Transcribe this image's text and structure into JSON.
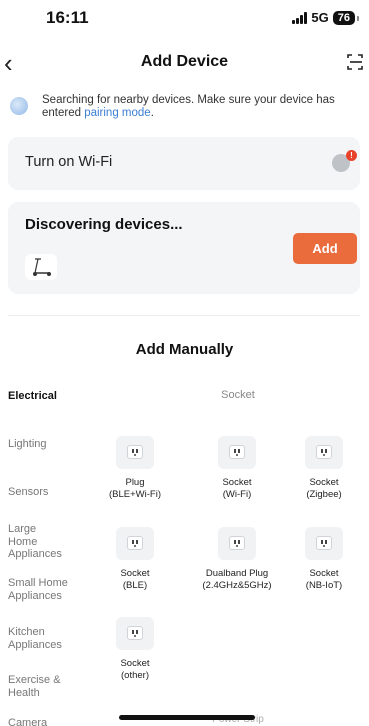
{
  "status_bar": {
    "time": "16:11",
    "network": "5G",
    "battery": "76"
  },
  "nav": {
    "title": "Add Device"
  },
  "hint": {
    "text": "Searching for nearby devices. Make sure your device has entered ",
    "link": "pairing mode",
    "suffix": "."
  },
  "wifi": {
    "label": "Turn on Wi-Fi",
    "badge": "!"
  },
  "discover": {
    "title": "Discovering devices...",
    "add_label": "Add"
  },
  "manual": {
    "title": "Add Manually",
    "column_header": "Socket",
    "categories": [
      "Electrical",
      "Lighting",
      "Sensors",
      "Large Home Appliances",
      "Small Home Appliances",
      "Kitchen Appliances",
      "Exercise & Health",
      "Camera"
    ],
    "devices": [
      {
        "name": "Plug",
        "sub": "(BLE+Wi-Fi)"
      },
      {
        "name": "Socket",
        "sub": "(Wi-Fi)"
      },
      {
        "name": "Socket",
        "sub": "(Zigbee)"
      },
      {
        "name": "Socket",
        "sub": "(BLE)"
      },
      {
        "name": "Dualband Plug",
        "sub": "(2.4GHz&5GHz)"
      },
      {
        "name": "Socket",
        "sub": "(NB-IoT)"
      },
      {
        "name": "Socket",
        "sub": "(other)"
      }
    ],
    "next_header": "Power Strip"
  },
  "colors": {
    "accent": "#ea6c3d",
    "link": "#3b7fd4",
    "card_bg": "#f4f5f7",
    "badge": "#e8422b"
  }
}
